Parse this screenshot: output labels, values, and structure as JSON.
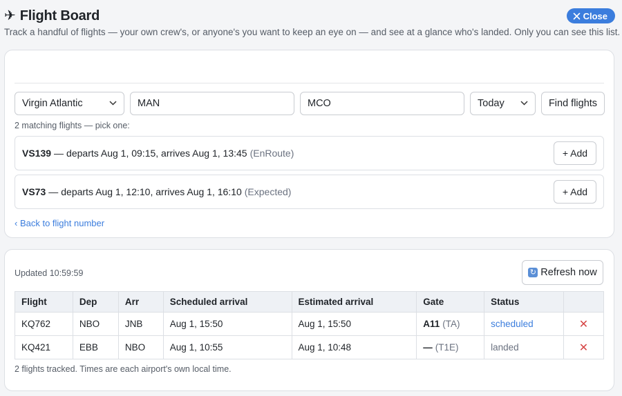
{
  "header": {
    "plane_glyph": "✈",
    "title": "Flight Board",
    "close_label": "Close",
    "subtitle": "Track a handful of flights — your own crew's, or anyone's you want to keep an eye on — and see at a glance who's landed. Only you can see this list."
  },
  "search": {
    "airline": "Virgin Atlantic",
    "origin": "MAN",
    "destination": "MCO",
    "date": "Today",
    "find_label": "Find flights",
    "hint": "2 matching flights — pick one:",
    "results": [
      {
        "code": "VS139",
        "details": "departs Aug 1, 09:15, arrives Aug 1, 13:45",
        "status": "(EnRoute)",
        "add_label": "+ Add"
      },
      {
        "code": "VS73",
        "details": "departs Aug 1, 12:10, arrives Aug 1, 16:10",
        "status": "(Expected)",
        "add_label": "+ Add"
      }
    ],
    "back_label": "‹ Back to flight number"
  },
  "board": {
    "updated": "Updated 10:59:59",
    "refresh_label": "Refresh now",
    "columns": [
      "Flight",
      "Dep",
      "Arr",
      "Scheduled arrival",
      "Estimated arrival",
      "Gate",
      "Status",
      ""
    ],
    "rows": [
      {
        "flight": "KQ762",
        "dep": "NBO",
        "arr": "JNB",
        "scheduled": "Aug 1, 15:50",
        "estimated": "Aug 1, 15:50",
        "gate": "A11",
        "terminal": "(TA)",
        "status": "scheduled",
        "remove": "✕"
      },
      {
        "flight": "KQ421",
        "dep": "EBB",
        "arr": "NBO",
        "scheduled": "Aug 1, 10:55",
        "estimated": "Aug 1, 10:48",
        "gate": "—",
        "terminal": "(T1E)",
        "status": "landed",
        "remove": "✕"
      }
    ],
    "footer": "2 flights tracked. Times are each airport's own local time."
  },
  "colors": {
    "accent": "#3b7ddd",
    "danger": "#d64545",
    "background": "#f4f5f7"
  }
}
